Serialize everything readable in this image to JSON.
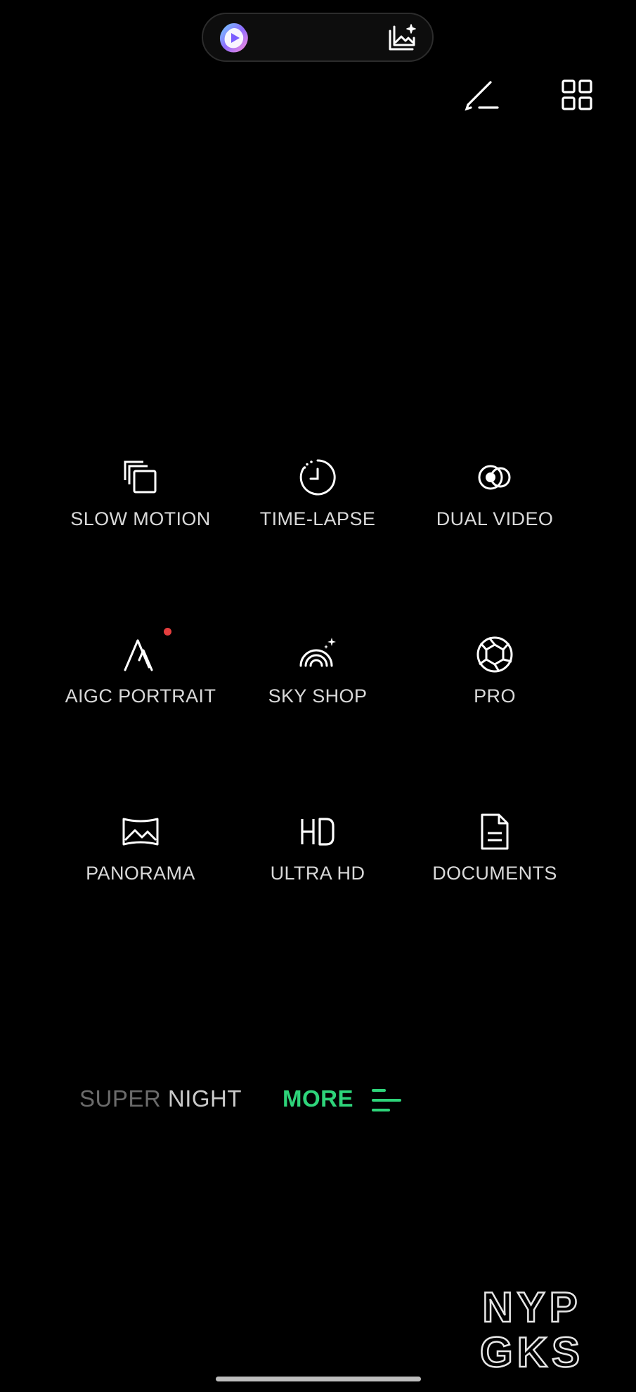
{
  "top_bar": {
    "left_icon": "ai-logo-icon",
    "right_icon": "ai-image-edit-icon",
    "edit_icon": "edit-pen-icon",
    "grid_icon": "grid-icon"
  },
  "modes": [
    {
      "label": "SLOW MOTION",
      "icon": "slow-motion-icon"
    },
    {
      "label": "TIME-LAPSE",
      "icon": "timer-icon"
    },
    {
      "label": "DUAL VIDEO",
      "icon": "dual-video-icon"
    },
    {
      "label": "AIGC PORTRAIT",
      "icon": "aigc-portrait-icon",
      "badge": "new-dot"
    },
    {
      "label": "SKY SHOP",
      "icon": "sky-shop-icon"
    },
    {
      "label": "PRO",
      "icon": "aperture-icon"
    },
    {
      "label": "PANORAMA",
      "icon": "panorama-icon"
    },
    {
      "label": "ULTRA HD",
      "icon": "hd-icon"
    },
    {
      "label": "DOCUMENTS",
      "icon": "document-icon"
    }
  ],
  "mode_bar": {
    "faded_part": "SUPER",
    "current_part": " NIGHT",
    "more_label": "MORE",
    "more_icon": "menu-lines-icon"
  },
  "watermark": {
    "line1": "NYP",
    "line2": "GKS"
  },
  "colors": {
    "accent_green": "#2ed47a",
    "badge_red": "#e53e3e",
    "background": "#000000"
  }
}
